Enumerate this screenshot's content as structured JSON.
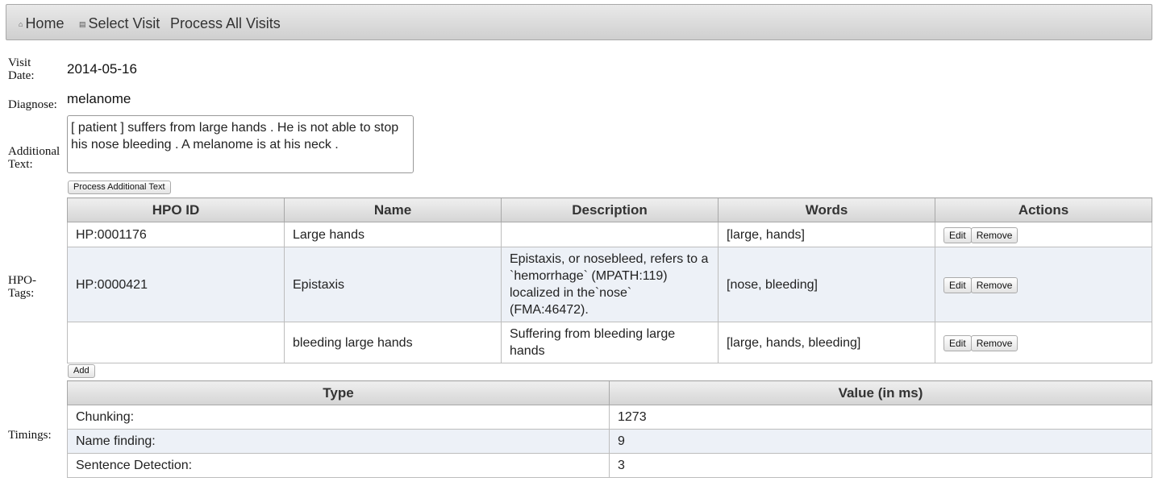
{
  "nav": {
    "home": "Home",
    "select_visit": "Select Visit",
    "process_all": "Process All Visits",
    "home_icon": "home-icon",
    "select_icon": "list-icon"
  },
  "visit": {
    "date_label": "Visit Date:",
    "date_value": "2014-05-16",
    "diagnose_label": "Diagnose:",
    "diagnose_value": "melanome",
    "additional_label": "Additional Text:",
    "additional_value": "[ patient ] suffers from large hands . He is not able to stop his nose bleeding . A melanome is at his neck .",
    "process_button": "Process Additional Text"
  },
  "hpo": {
    "label": "HPO-Tags:",
    "columns": [
      "HPO ID",
      "Name",
      "Description",
      "Words",
      "Actions"
    ],
    "rows": [
      {
        "id": "HP:0001176",
        "name": "Large hands",
        "description": "",
        "words": "[large, hands]"
      },
      {
        "id": "HP:0000421",
        "name": "Epistaxis",
        "description": "Epistaxis, or nosebleed, refers to a `hemorrhage` (MPATH:119) localized in the`nose` (FMA:46472).",
        "words": "[nose, bleeding]"
      },
      {
        "id": "",
        "name": "bleeding large hands",
        "description": "Suffering from bleeding large hands",
        "words": "[large, hands, bleeding]"
      }
    ],
    "edit_label": "Edit",
    "remove_label": "Remove",
    "add_button": "Add"
  },
  "timings": {
    "label": "Timings:",
    "columns": [
      "Type",
      "Value (in ms)"
    ],
    "rows": [
      {
        "type": "Chunking:",
        "value": "1273"
      },
      {
        "type": "Name finding:",
        "value": "9"
      },
      {
        "type": "Sentence Detection:",
        "value": "3"
      }
    ]
  }
}
